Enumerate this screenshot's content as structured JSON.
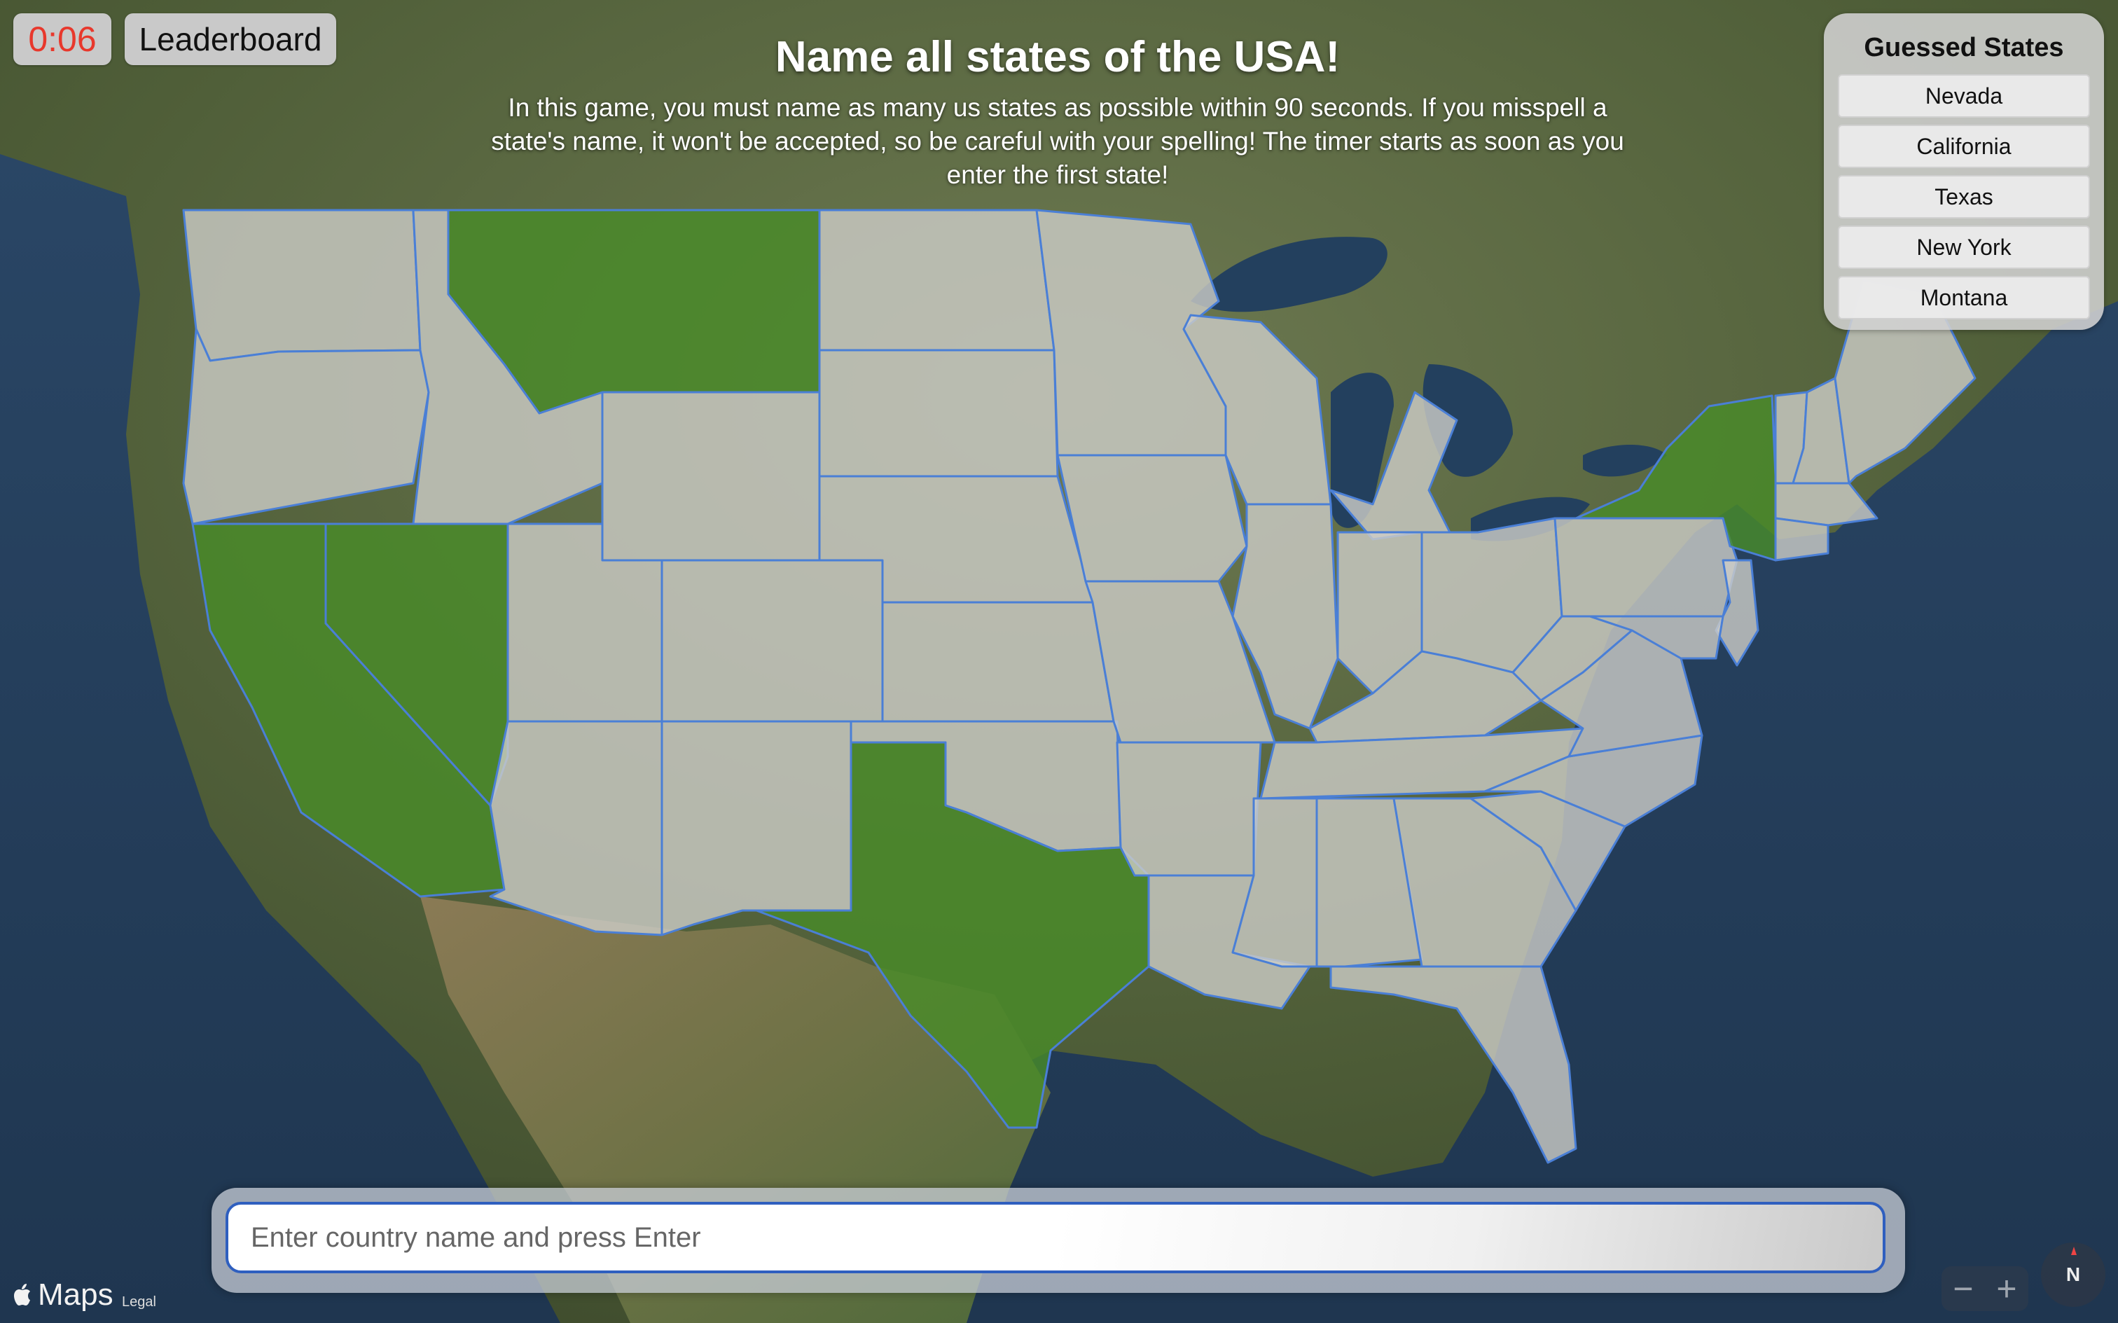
{
  "timer": {
    "text": "0:06",
    "color": "#e8382c"
  },
  "toolbar": {
    "leaderboard_label": "Leaderboard"
  },
  "header": {
    "title": "Name all states of the USA!",
    "description": "In this game, you must name as many us states as possible within 90 seconds. If you misspell a state's name, it won't be accepted, so be careful with your spelling! The timer starts as soon as you enter the first state!"
  },
  "guessed_panel": {
    "title": "Guessed States",
    "states": [
      "Nevada",
      "California",
      "Texas",
      "New York",
      "Montana"
    ]
  },
  "input": {
    "placeholder": "Enter country name and press Enter",
    "value": ""
  },
  "map": {
    "attribution": "Maps",
    "legal_label": "Legal",
    "zoom_out_label": "−",
    "zoom_in_label": "+",
    "compass_label": "N",
    "colors": {
      "guessed": "#488c28",
      "unguessed": "#cdcdc8",
      "border": "#4a7fd6",
      "ocean": "#2c4a6b"
    },
    "states": [
      {
        "name": "Washington",
        "guessed": false
      },
      {
        "name": "Oregon",
        "guessed": false
      },
      {
        "name": "California",
        "guessed": true
      },
      {
        "name": "Nevada",
        "guessed": true
      },
      {
        "name": "Idaho",
        "guessed": false
      },
      {
        "name": "Montana",
        "guessed": true
      },
      {
        "name": "Wyoming",
        "guessed": false
      },
      {
        "name": "Utah",
        "guessed": false
      },
      {
        "name": "Arizona",
        "guessed": false
      },
      {
        "name": "Colorado",
        "guessed": false
      },
      {
        "name": "New Mexico",
        "guessed": false
      },
      {
        "name": "North Dakota",
        "guessed": false
      },
      {
        "name": "South Dakota",
        "guessed": false
      },
      {
        "name": "Nebraska",
        "guessed": false
      },
      {
        "name": "Kansas",
        "guessed": false
      },
      {
        "name": "Oklahoma",
        "guessed": false
      },
      {
        "name": "Texas",
        "guessed": true
      },
      {
        "name": "Minnesota",
        "guessed": false
      },
      {
        "name": "Iowa",
        "guessed": false
      },
      {
        "name": "Missouri",
        "guessed": false
      },
      {
        "name": "Arkansas",
        "guessed": false
      },
      {
        "name": "Louisiana",
        "guessed": false
      },
      {
        "name": "Wisconsin",
        "guessed": false
      },
      {
        "name": "Illinois",
        "guessed": false
      },
      {
        "name": "Michigan",
        "guessed": false
      },
      {
        "name": "Indiana",
        "guessed": false
      },
      {
        "name": "Ohio",
        "guessed": false
      },
      {
        "name": "Kentucky",
        "guessed": false
      },
      {
        "name": "Tennessee",
        "guessed": false
      },
      {
        "name": "Mississippi",
        "guessed": false
      },
      {
        "name": "Alabama",
        "guessed": false
      },
      {
        "name": "Georgia",
        "guessed": false
      },
      {
        "name": "Florida",
        "guessed": false
      },
      {
        "name": "South Carolina",
        "guessed": false
      },
      {
        "name": "North Carolina",
        "guessed": false
      },
      {
        "name": "Virginia",
        "guessed": false
      },
      {
        "name": "West Virginia",
        "guessed": false
      },
      {
        "name": "Pennsylvania",
        "guessed": false
      },
      {
        "name": "New York",
        "guessed": true
      },
      {
        "name": "Vermont",
        "guessed": false
      },
      {
        "name": "New Hampshire",
        "guessed": false
      },
      {
        "name": "Maine",
        "guessed": false
      },
      {
        "name": "Massachusetts",
        "guessed": false
      },
      {
        "name": "Connecticut",
        "guessed": false
      },
      {
        "name": "New Jersey",
        "guessed": false
      },
      {
        "name": "Maryland",
        "guessed": false
      }
    ]
  }
}
